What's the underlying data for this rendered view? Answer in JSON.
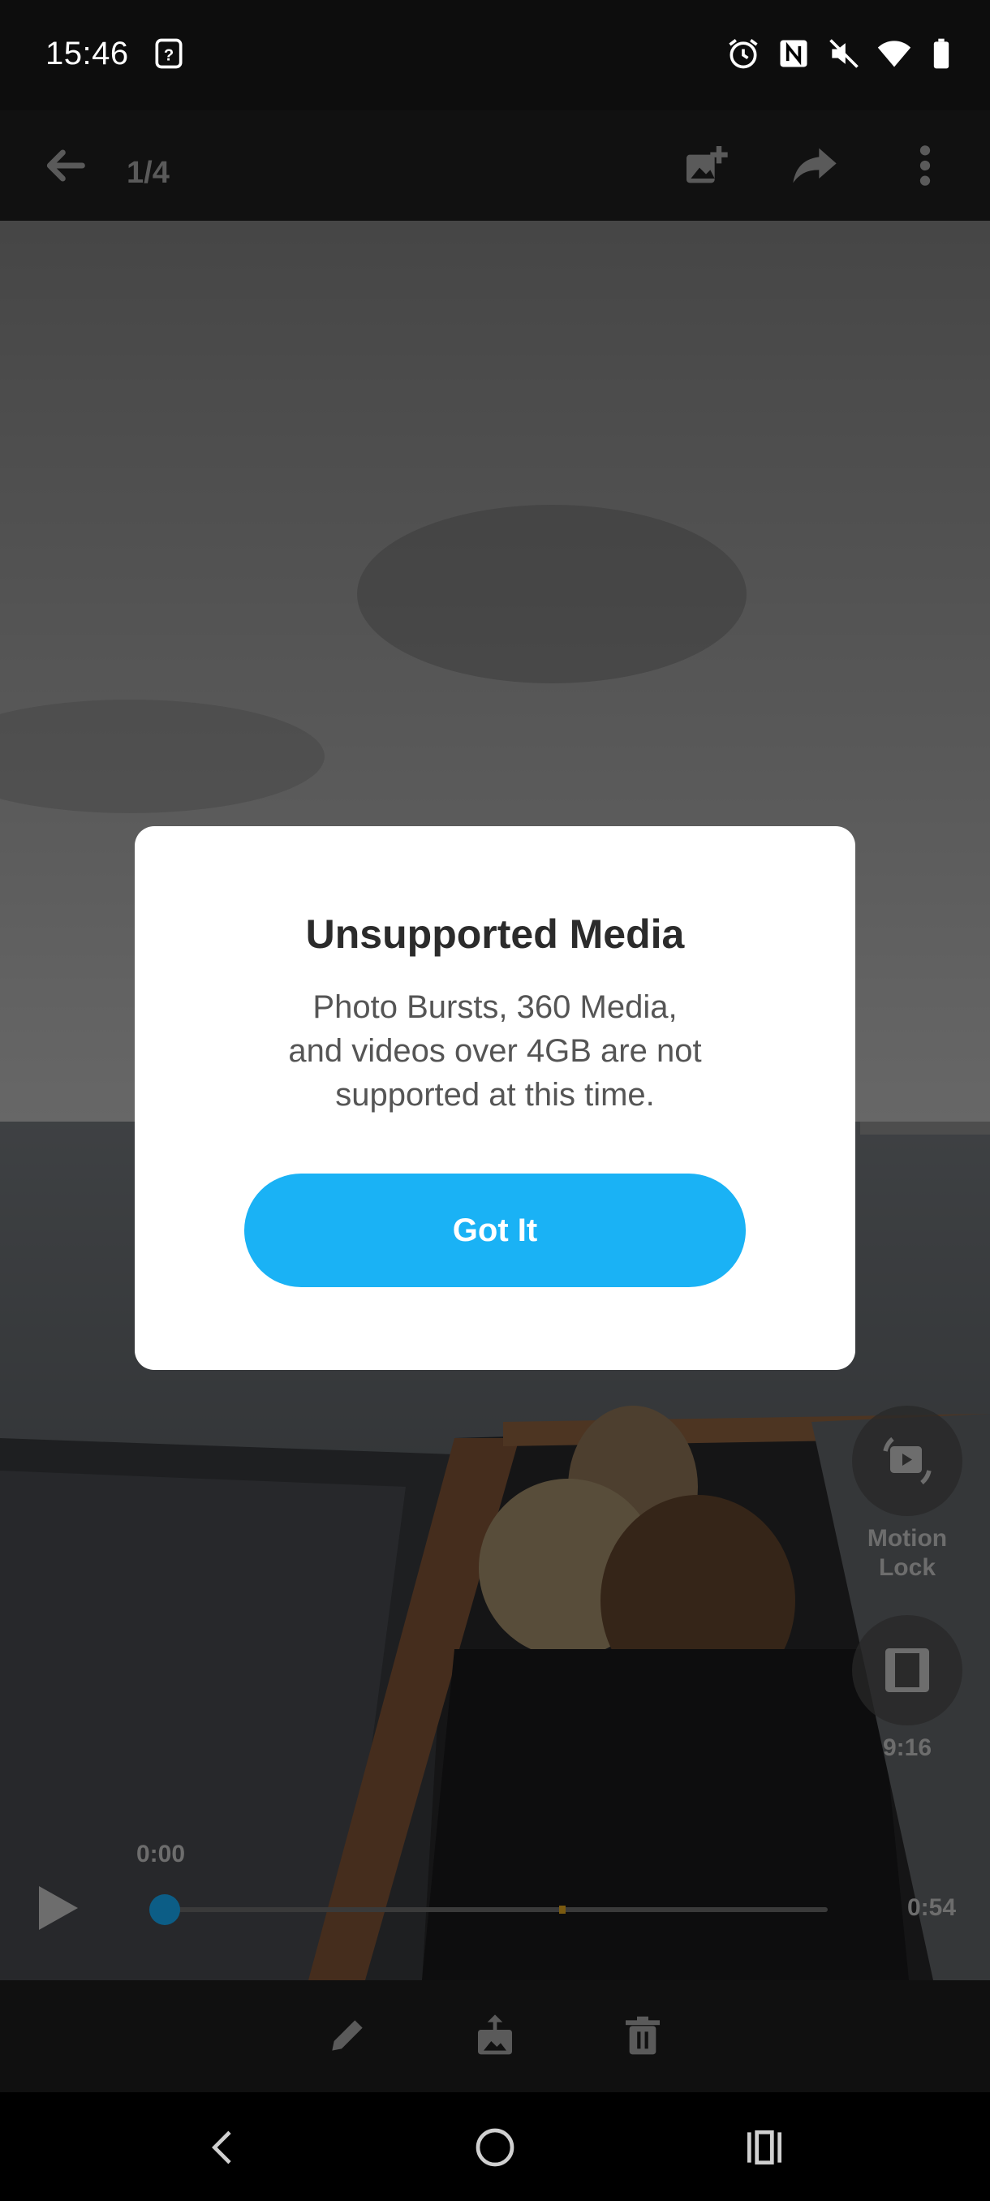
{
  "status_bar": {
    "time": "15:46",
    "icons": [
      "unknown-sim-icon",
      "alarm-icon",
      "nfc-icon",
      "mute-icon",
      "wifi-icon",
      "battery-icon"
    ]
  },
  "app_bar": {
    "counter": "1/4",
    "icons": [
      "back-arrow-icon",
      "add-to-album-icon",
      "share-icon",
      "more-icon"
    ]
  },
  "side_controls": {
    "motion_lock_label_line1": "Motion",
    "motion_lock_label_line2": "Lock",
    "aspect_label": "9:16"
  },
  "playback": {
    "time_start": "0:00",
    "time_end": "0:54",
    "progress": 0
  },
  "bottom_bar": {
    "icons": [
      "edit-pencil-icon",
      "export-image-icon",
      "trash-icon"
    ]
  },
  "nav_bar": {
    "icons": [
      "nav-back-icon",
      "nav-home-icon",
      "nav-recents-icon"
    ]
  },
  "dialog": {
    "title": "Unsupported Media",
    "body_line1": "Photo Bursts, 360 Media,",
    "body_line2": "and videos over 4GB are not",
    "body_line3": "supported at this time.",
    "button_label": "Got It"
  },
  "colors": {
    "accent": "#1ab2f5",
    "dialog_bg": "#ffffff",
    "title_text": "#2b2b2b",
    "body_text": "#555555",
    "scrub_dot": "#0c5d86"
  }
}
